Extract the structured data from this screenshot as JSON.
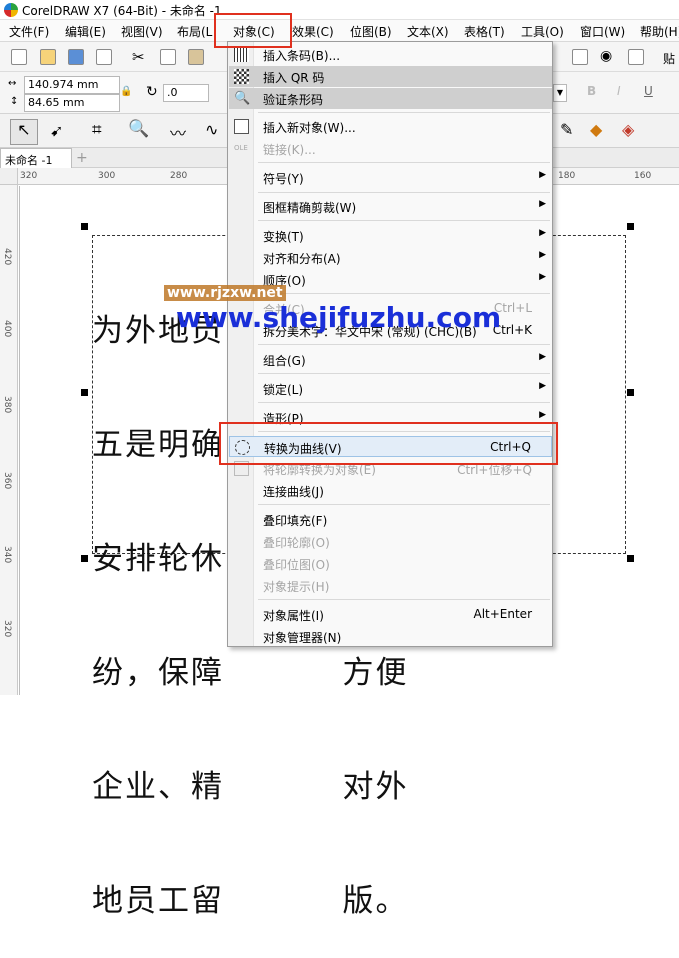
{
  "window": {
    "title": "CorelDRAW X7 (64-Bit) - 未命名 -1"
  },
  "menubar": {
    "items": [
      "文件(F)",
      "编辑(E)",
      "视图(V)",
      "布局(L",
      "对象(C)",
      "效果(C)",
      "位图(B)",
      "文本(X)",
      "表格(T)",
      "工具(O)",
      "窗口(W)",
      "帮助(H)"
    ]
  },
  "toolbar": {
    "paste_label": "贴"
  },
  "propbar": {
    "width_value": "140.974 mm",
    "height_value": "84.65 mm",
    "angle_value": ".0"
  },
  "tabs": {
    "doc_tab": "未命名 -1",
    "add_tab": "+"
  },
  "ruler": {
    "h_ticks": [
      "320",
      "300",
      "280",
      "180",
      "160"
    ],
    "v_ticks": [
      "420",
      "400",
      "380",
      "360",
      "340",
      "320"
    ]
  },
  "canvas_text": {
    "lines": [
      "为外地员          务。",
      "五是明确          费和",
      "安排轮休          出",
      "纷，保障          方便",
      "企业、精          对外",
      "地员工留          版。"
    ]
  },
  "object_menu": {
    "items": [
      {
        "label": "插入条码(B)...",
        "shortcut": "",
        "submenu": false,
        "disabled": false,
        "icon": "barcode-icon"
      },
      {
        "label": "插入 QR 码",
        "shortcut": "",
        "submenu": false,
        "disabled": false,
        "icon": "qr-code-icon"
      },
      {
        "label": "验证条形码",
        "shortcut": "",
        "submenu": false,
        "disabled": false,
        "icon": "verify-barcode-icon"
      },
      {
        "label": "插入新对象(W)...",
        "shortcut": "",
        "submenu": false,
        "disabled": false,
        "icon": "insert-object-icon"
      },
      {
        "label": "链接(K)...",
        "shortcut": "",
        "submenu": false,
        "disabled": true,
        "icon": "ole-icon"
      },
      {
        "label": "符号(Y)",
        "shortcut": "",
        "submenu": true,
        "disabled": false,
        "icon": ""
      },
      {
        "label": "图框精确剪裁(W)",
        "shortcut": "",
        "submenu": true,
        "disabled": false,
        "icon": ""
      },
      {
        "label": "变换(T)",
        "shortcut": "",
        "submenu": true,
        "disabled": false,
        "icon": ""
      },
      {
        "label": "对齐和分布(A)",
        "shortcut": "",
        "submenu": true,
        "disabled": false,
        "icon": ""
      },
      {
        "label": "顺序(O)",
        "shortcut": "",
        "submenu": true,
        "disabled": false,
        "icon": ""
      },
      {
        "label": "合并(C)",
        "shortcut": "Ctrl+L",
        "submenu": false,
        "disabled": true,
        "icon": ""
      },
      {
        "label": "拆分美术字：华文中宋 (常规) (CHC)(B)",
        "shortcut": "Ctrl+K",
        "submenu": false,
        "disabled": false,
        "icon": ""
      },
      {
        "label": "组合(G)",
        "shortcut": "",
        "submenu": true,
        "disabled": false,
        "icon": ""
      },
      {
        "label": "锁定(L)",
        "shortcut": "",
        "submenu": true,
        "disabled": false,
        "icon": ""
      },
      {
        "label": "造形(P)",
        "shortcut": "",
        "submenu": true,
        "disabled": false,
        "icon": ""
      },
      {
        "label": "转换为曲线(V)",
        "shortcut": "Ctrl+Q",
        "submenu": false,
        "disabled": false,
        "icon": "convert-to-curves-icon"
      },
      {
        "label": "将轮廓转换为对象(E)",
        "shortcut": "Ctrl+位移+Q",
        "submenu": false,
        "disabled": true,
        "icon": ""
      },
      {
        "label": "连接曲线(J)",
        "shortcut": "",
        "submenu": false,
        "disabled": false,
        "icon": ""
      },
      {
        "label": "叠印填充(F)",
        "shortcut": "",
        "submenu": false,
        "disabled": false,
        "icon": ""
      },
      {
        "label": "叠印轮廓(O)",
        "shortcut": "",
        "submenu": false,
        "disabled": true,
        "icon": ""
      },
      {
        "label": "叠印位图(O)",
        "shortcut": "",
        "submenu": false,
        "disabled": true,
        "icon": ""
      },
      {
        "label": "对象提示(H)",
        "shortcut": "",
        "submenu": false,
        "disabled": true,
        "icon": ""
      },
      {
        "label": "对象属性(I)",
        "shortcut": "Alt+Enter",
        "submenu": false,
        "disabled": false,
        "icon": ""
      },
      {
        "label": "对象管理器(N)",
        "shortcut": "",
        "submenu": false,
        "disabled": false,
        "icon": ""
      }
    ]
  },
  "watermarks": {
    "small": "www.rjzxw.net",
    "large": "www.shejifuzhu.com"
  },
  "colors": {
    "highlight_box": "#e0301e",
    "watermark_blue": "#1a2fd8"
  }
}
